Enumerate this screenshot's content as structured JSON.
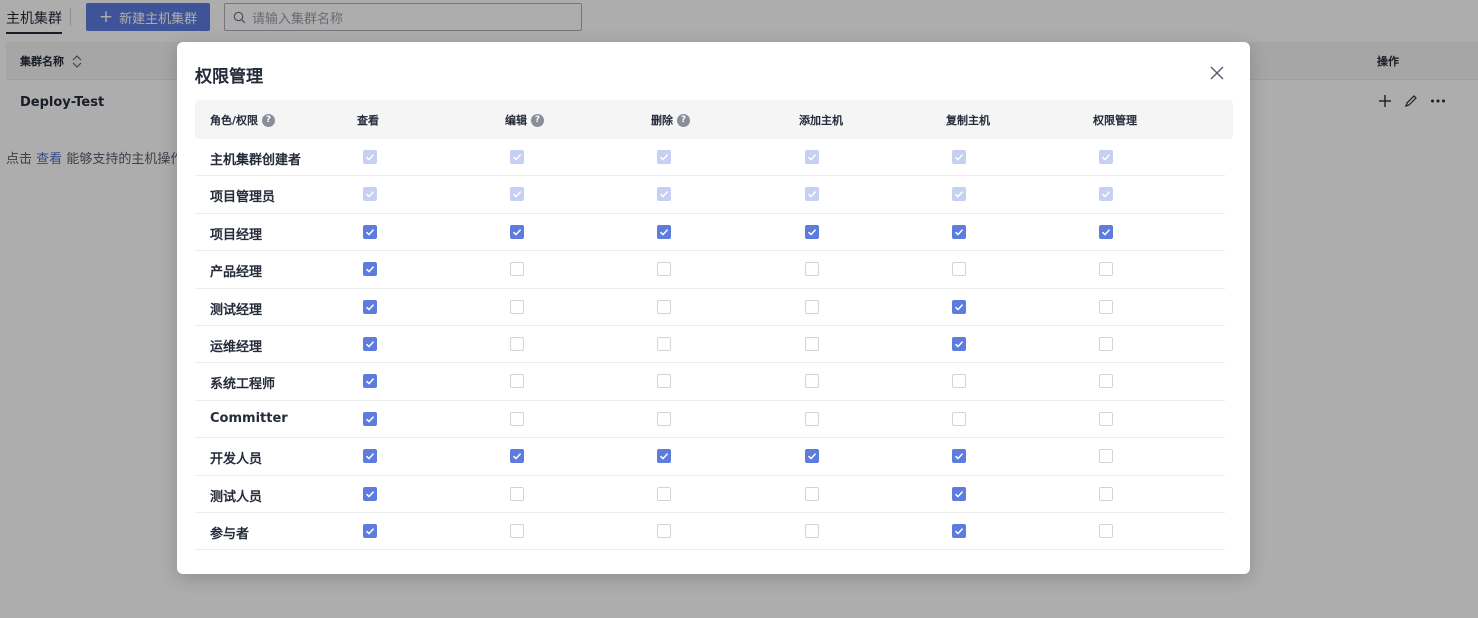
{
  "topbar": {
    "tab_label": "主机集群",
    "new_button_label": "新建主机集群",
    "search_placeholder": "请输入集群名称"
  },
  "cluster_table": {
    "col_name": "集群名称",
    "col_actions": "操作",
    "row_name": "Deploy-Test"
  },
  "tip": {
    "prefix": "点击",
    "link": "查看",
    "suffix": "能够支持的主机操作"
  },
  "modal": {
    "title": "权限管理",
    "headers": [
      "角色/权限",
      "查看",
      "编辑",
      "删除",
      "添加主机",
      "复制主机",
      "权限管理"
    ],
    "rows": [
      {
        "role": "主机集群创建者",
        "perms": [
          "disabled",
          "disabled",
          "disabled",
          "disabled",
          "disabled",
          "disabled"
        ]
      },
      {
        "role": "项目管理员",
        "perms": [
          "disabled",
          "disabled",
          "disabled",
          "disabled",
          "disabled",
          "disabled"
        ]
      },
      {
        "role": "项目经理",
        "perms": [
          "checked",
          "checked",
          "checked",
          "checked",
          "checked",
          "checked"
        ]
      },
      {
        "role": "产品经理",
        "perms": [
          "checked",
          "unchecked",
          "unchecked",
          "unchecked",
          "unchecked",
          "unchecked"
        ]
      },
      {
        "role": "测试经理",
        "perms": [
          "checked",
          "unchecked",
          "unchecked",
          "unchecked",
          "checked",
          "unchecked"
        ]
      },
      {
        "role": "运维经理",
        "perms": [
          "checked",
          "unchecked",
          "unchecked",
          "unchecked",
          "checked",
          "unchecked"
        ]
      },
      {
        "role": "系统工程师",
        "perms": [
          "checked",
          "unchecked",
          "unchecked",
          "unchecked",
          "unchecked",
          "unchecked"
        ]
      },
      {
        "role": "Committer",
        "perms": [
          "checked",
          "unchecked",
          "unchecked",
          "unchecked",
          "unchecked",
          "unchecked"
        ]
      },
      {
        "role": "开发人员",
        "perms": [
          "checked",
          "checked",
          "checked",
          "checked",
          "checked",
          "unchecked"
        ]
      },
      {
        "role": "测试人员",
        "perms": [
          "checked",
          "unchecked",
          "unchecked",
          "unchecked",
          "checked",
          "unchecked"
        ]
      },
      {
        "role": "参与者",
        "perms": [
          "checked",
          "unchecked",
          "unchecked",
          "unchecked",
          "checked",
          "unchecked"
        ]
      }
    ]
  },
  "colors": {
    "primary": "#5e7ce0",
    "disabled_check": "#c6d0f2",
    "mask": "rgba(0,0,0,0.32)"
  },
  "icons": [
    "search-icon",
    "sort-icon",
    "plus-icon",
    "edit-icon",
    "more-icon",
    "close-icon",
    "help-icon",
    "check-icon"
  ]
}
